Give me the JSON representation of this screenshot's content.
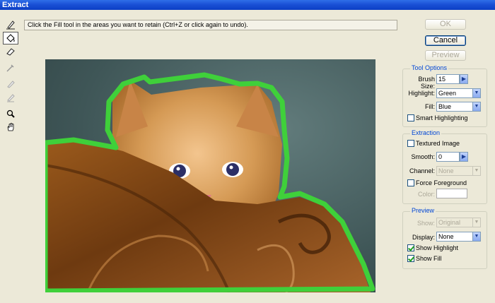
{
  "window": {
    "title": "Extract"
  },
  "hint": "Click the Fill tool in the areas you want to retain (Ctrl+Z or click again to undo).",
  "buttons": {
    "ok": "OK",
    "cancel": "Cancel",
    "preview": "Preview"
  },
  "tools": [
    {
      "name": "edge-highlighter-icon",
      "active": false
    },
    {
      "name": "fill-bucket-icon",
      "active": true
    },
    {
      "name": "eraser-icon",
      "active": false
    },
    {
      "name": "eyedropper-icon",
      "active": false
    },
    {
      "name": "cleanup-icon",
      "active": false
    },
    {
      "name": "edge-touchup-icon",
      "active": false
    },
    {
      "name": "zoom-icon",
      "active": false
    },
    {
      "name": "hand-icon",
      "active": false
    }
  ],
  "tool_options": {
    "title": "Tool Options",
    "brush_size_label": "Brush Size:",
    "brush_size": "15",
    "highlight_label": "Highlight:",
    "highlight": "Green",
    "fill_label": "Fill:",
    "fill": "Blue",
    "smart_highlighting": "Smart Highlighting",
    "smart_highlighting_checked": false
  },
  "extraction": {
    "title": "Extraction",
    "textured_image": "Textured Image",
    "textured_image_checked": false,
    "smooth_label": "Smooth:",
    "smooth": "0",
    "channel_label": "Channel:",
    "channel": "None",
    "force_foreground": "Force Foreground",
    "force_foreground_checked": false,
    "color_label": "Color:"
  },
  "preview_group": {
    "title": "Preview",
    "show_label": "Show:",
    "show": "Original",
    "display_label": "Display:",
    "display": "None",
    "show_highlight": "Show Highlight",
    "show_highlight_checked": true,
    "show_fill": "Show Fill",
    "show_fill_checked": true
  },
  "colors": {
    "highlight": "#3fd03a",
    "title_bar": "#0b3fc4",
    "group_title": "#0046d5"
  }
}
